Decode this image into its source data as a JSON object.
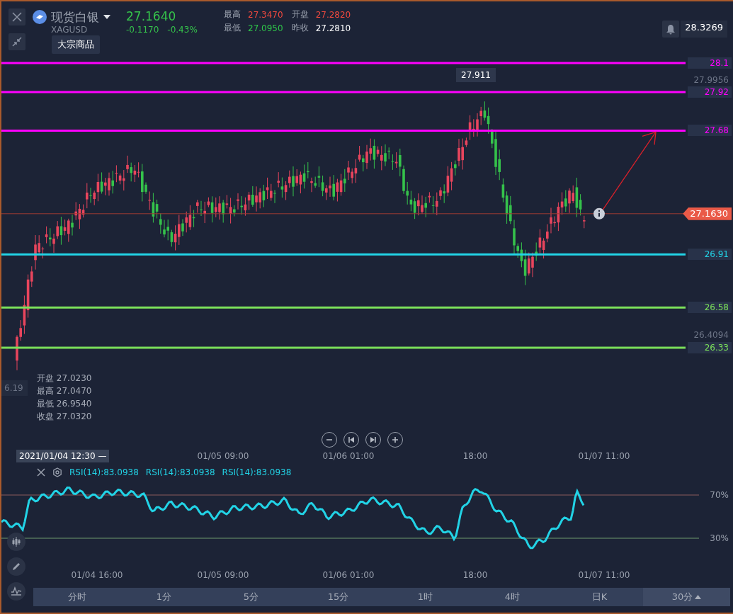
{
  "header": {
    "symbol": "现货白银",
    "code": "XAGUSD",
    "tooltip": "大宗商品",
    "price": "27.1640",
    "change": "-0.1170",
    "change_pct": "-0.43%",
    "quotes": [
      {
        "label": "最高",
        "value": "27.3470",
        "color": "#f0493e"
      },
      {
        "label": "开盘",
        "value": "27.2820",
        "color": "#f0493e"
      },
      {
        "label": "最低",
        "value": "27.0950",
        "color": "#2fc54a"
      },
      {
        "label": "昨收",
        "value": "27.2810",
        "color": "#ffffff"
      }
    ],
    "alert_price": "28.3269"
  },
  "chart": {
    "levels": [
      {
        "price": "28.1",
        "color": "#ff00ff"
      },
      {
        "price": "27.92",
        "color": "#ff00ff"
      },
      {
        "price": "27.68",
        "color": "#ff00ff"
      },
      {
        "price": "26.91",
        "color": "#22d3e6"
      },
      {
        "price": "26.58",
        "color": "#7be05a"
      },
      {
        "price": "26.33",
        "color": "#7be05a"
      }
    ],
    "axis_high": "27.9956",
    "axis_low": "26.4094",
    "peak": "27.911",
    "current_price": "27.1630",
    "edge_label": "6.19",
    "ohlc": [
      {
        "label": "开盘",
        "value": "27.0230"
      },
      {
        "label": "最高",
        "value": "27.0470"
      },
      {
        "label": "最低",
        "value": "26.9540"
      },
      {
        "label": "收盘",
        "value": "27.0320"
      }
    ]
  },
  "time_axis": {
    "crosshair": "2021/01/04 12:30 —",
    "labels": [
      "01/05 09:00",
      "01/06 01:00",
      "18:00",
      "01/07 11:00"
    ]
  },
  "rsi": {
    "readings": [
      "RSI(14):83.0938",
      "RSI(14):83.0938",
      "RSI(14):83.0938"
    ],
    "levels": [
      "70%",
      "30%"
    ],
    "axis": [
      "01/04 16:00",
      "01/05 09:00",
      "01/06 01:00",
      "18:00",
      "01/07 11:00"
    ]
  },
  "timeframes": [
    {
      "label": "分时",
      "selected": false
    },
    {
      "label": "1分",
      "selected": false
    },
    {
      "label": "5分",
      "selected": false
    },
    {
      "label": "15分",
      "selected": false
    },
    {
      "label": "1时",
      "selected": false
    },
    {
      "label": "4时",
      "selected": false
    },
    {
      "label": "日K",
      "selected": false
    },
    {
      "label": "30分",
      "selected": true
    }
  ]
}
